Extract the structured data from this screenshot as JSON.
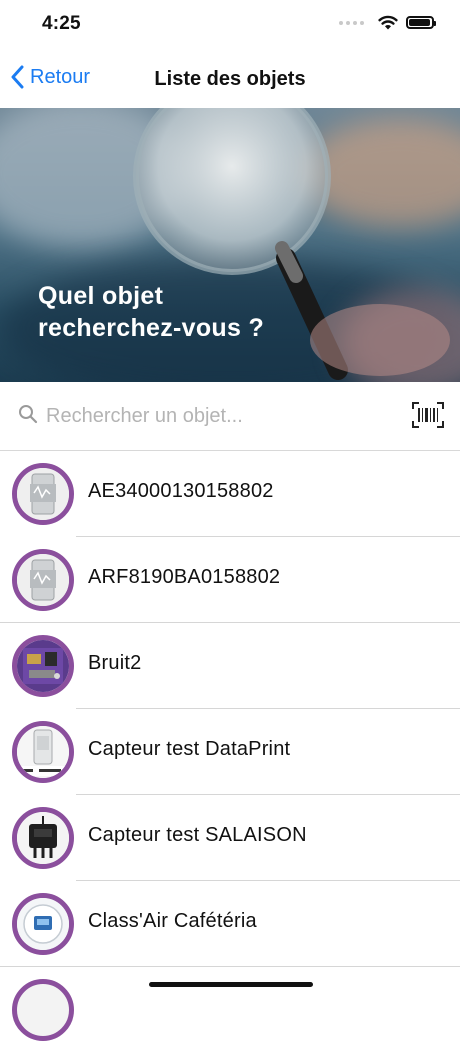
{
  "status_bar": {
    "time": "4:25"
  },
  "nav": {
    "back_label": "Retour",
    "title": "Liste des objets"
  },
  "hero": {
    "line1": "Quel objet",
    "line2": "recherchez-vous ?"
  },
  "search": {
    "placeholder": "Rechercher un objet...",
    "value": ""
  },
  "objects": [
    {
      "label": "AE34000130158802",
      "icon": "sensor-device-icon"
    },
    {
      "label": "ARF8190BA0158802",
      "icon": "sensor-device-icon"
    },
    {
      "label": "Bruit2",
      "icon": "circuit-board-icon"
    },
    {
      "label": "Capteur test DataPrint",
      "icon": "sensor-device-icon"
    },
    {
      "label": "Capteur test SALAISON",
      "icon": "black-sensor-icon"
    },
    {
      "label": "Class'Air Cafétéria",
      "icon": "air-quality-sensor-icon"
    }
  ],
  "colors": {
    "accent": "#1b7cf2",
    "avatar_ring": "#8b4f9d"
  }
}
